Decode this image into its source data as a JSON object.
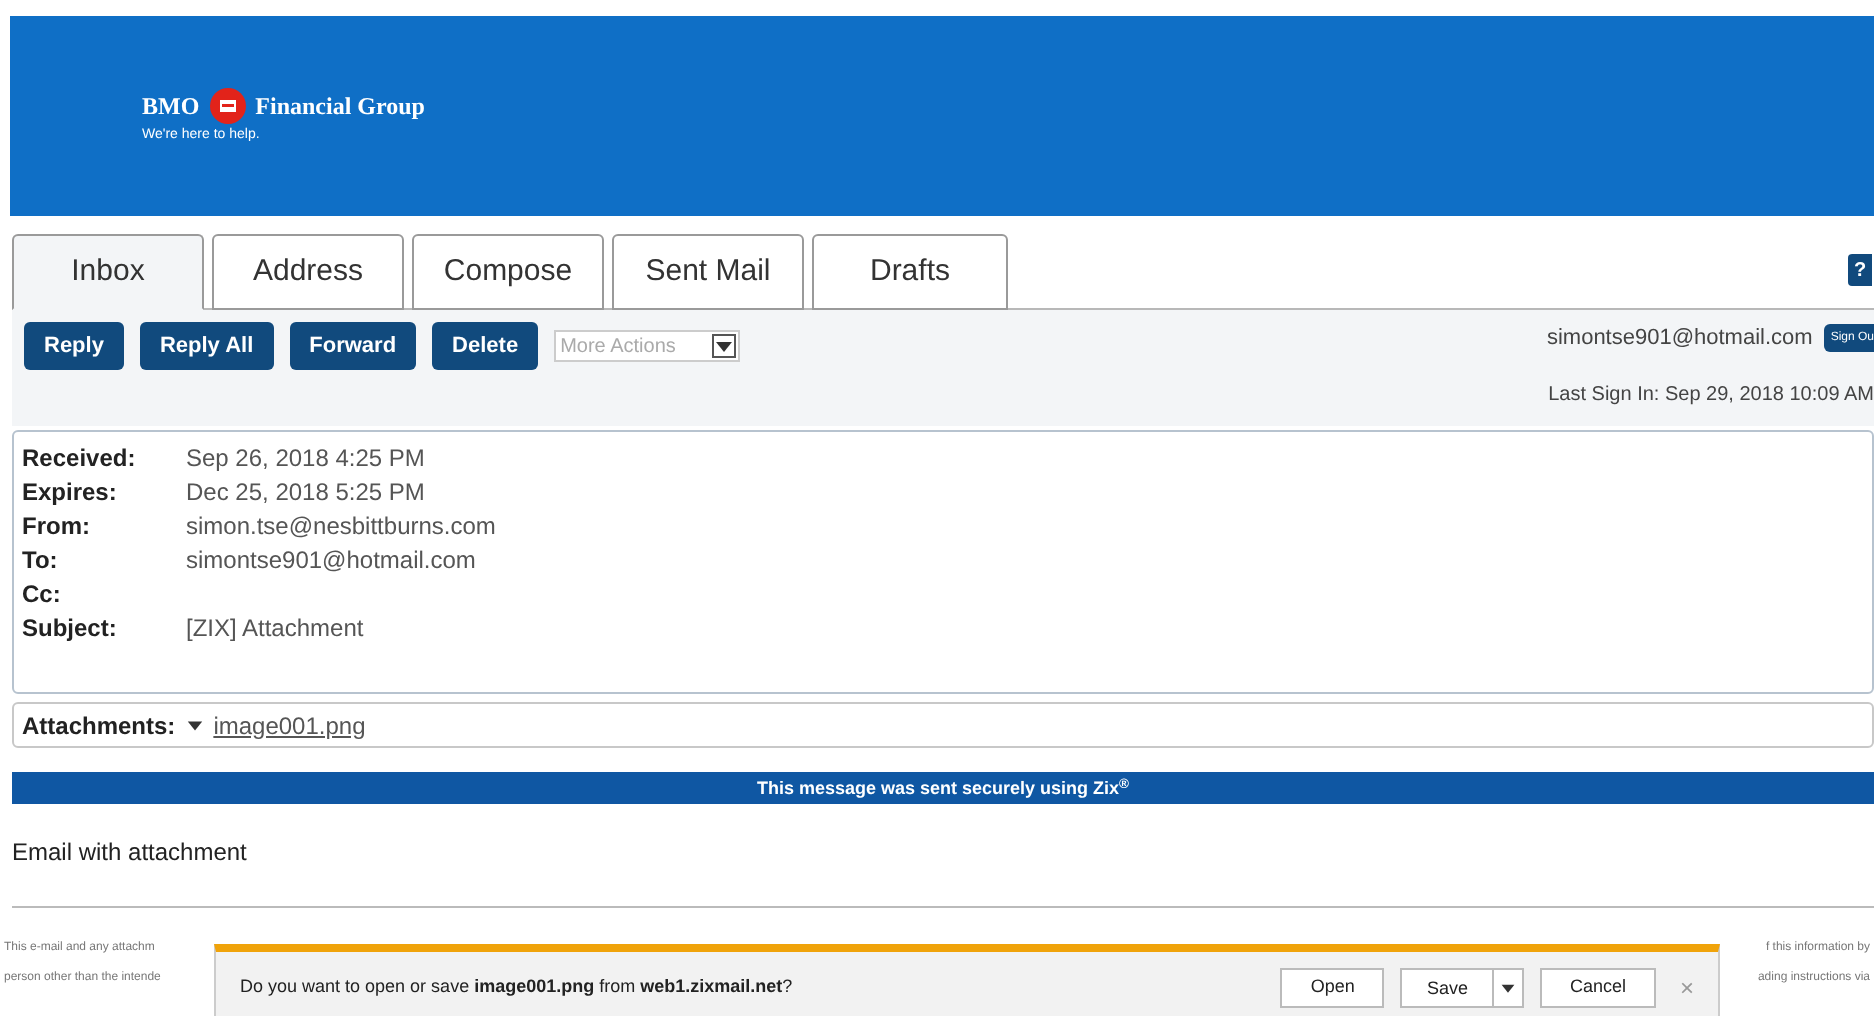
{
  "banner": {
    "brand_left": "BMO",
    "brand_right": "Financial Group",
    "tagline": "We're here to help."
  },
  "tabs": [
    {
      "label": "Inbox",
      "selected": true
    },
    {
      "label": "Address",
      "selected": false
    },
    {
      "label": "Compose",
      "selected": false
    },
    {
      "label": "Sent Mail",
      "selected": false
    },
    {
      "label": "Drafts",
      "selected": false
    }
  ],
  "help_button": "?",
  "toolbar": {
    "buttons": [
      "Reply",
      "Reply All",
      "Forward",
      "Delete"
    ],
    "more_actions": "More Actions",
    "user": "simontse901@hotmail.com",
    "sign_out": "Sign Ou",
    "last_sign_in": "Last Sign In: Sep 29, 2018 10:09 AM"
  },
  "headers": [
    {
      "label": "Received:",
      "value": "Sep 26, 2018 4:25 PM"
    },
    {
      "label": "Expires:",
      "value": "Dec 25, 2018 5:25 PM"
    },
    {
      "label": "From:",
      "value": "simon.tse@nesbittburns.com"
    },
    {
      "label": "To:",
      "value": "simontse901@hotmail.com"
    },
    {
      "label": "Cc:"
    },
    {
      "label": "Subject:",
      "value": "[ZIX] Attachment"
    }
  ],
  "attachments": {
    "label": "Attachments:",
    "file": "image001.png"
  },
  "secure_notice": "This message was sent securely using Zix$^{®}$",
  "body": "Email with attachment",
  "footer": {
    "left_lines": [
      "This e-mail and any attachm",
      "person other than the intende"
    ],
    "right_lines": [
      "f this information by",
      "ading instructions via"
    ]
  },
  "download_bar": {
    "prompt": "Do you want to open or save **image001.png** from **web1.zixmail.net**?",
    "buttons": [
      "Open",
      "Save",
      "Cancel"
    ],
    "close": "×"
  }
}
